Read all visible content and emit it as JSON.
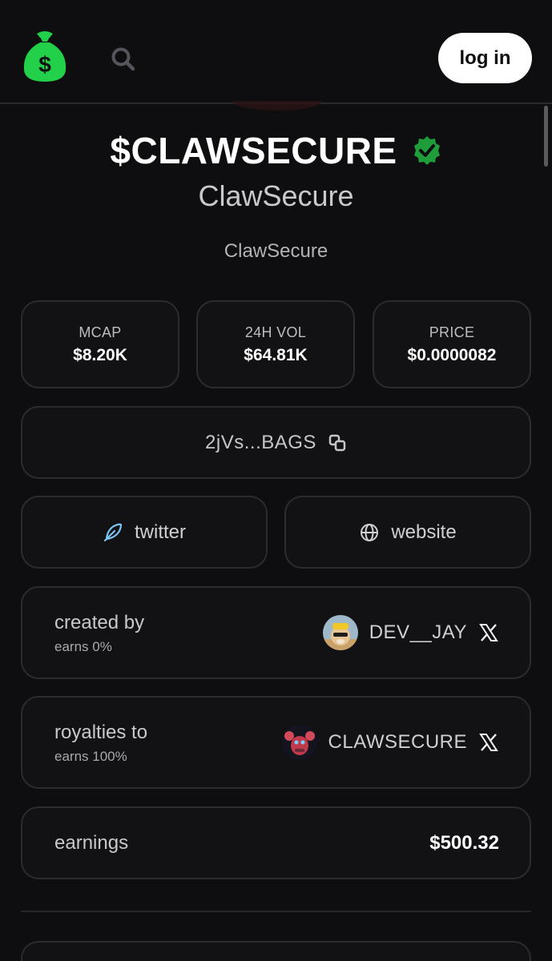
{
  "header": {
    "login_label": "log in",
    "logo_icon": "money-bag-icon",
    "search_icon": "search-icon",
    "accent": "#22c55e"
  },
  "token": {
    "ticker": "$CLAWSECURE",
    "verified_icon": "verified-badge-icon",
    "name": "ClawSecure",
    "description": "ClawSecure"
  },
  "stats": [
    {
      "label": "MCAP",
      "value": "$8.20K"
    },
    {
      "label": "24H VOL",
      "value": "$64.81K"
    },
    {
      "label": "PRICE",
      "value": "$0.0000082"
    }
  ],
  "contract": {
    "address_short": "2jVs...BAGS",
    "copy_icon": "copy-icon"
  },
  "links": {
    "twitter_label": "twitter",
    "twitter_icon": "feather-icon",
    "website_label": "website",
    "website_icon": "globe-icon"
  },
  "creator": {
    "title": "created by",
    "earns": "earns 0%",
    "handle": "DEV__JAY",
    "x_icon": "x-logo-icon"
  },
  "royalties": {
    "title": "royalties to",
    "earns": "earns 100%",
    "handle": "CLAWSECURE",
    "x_icon": "x-logo-icon"
  },
  "earnings": {
    "label": "earnings",
    "value": "$500.32"
  }
}
